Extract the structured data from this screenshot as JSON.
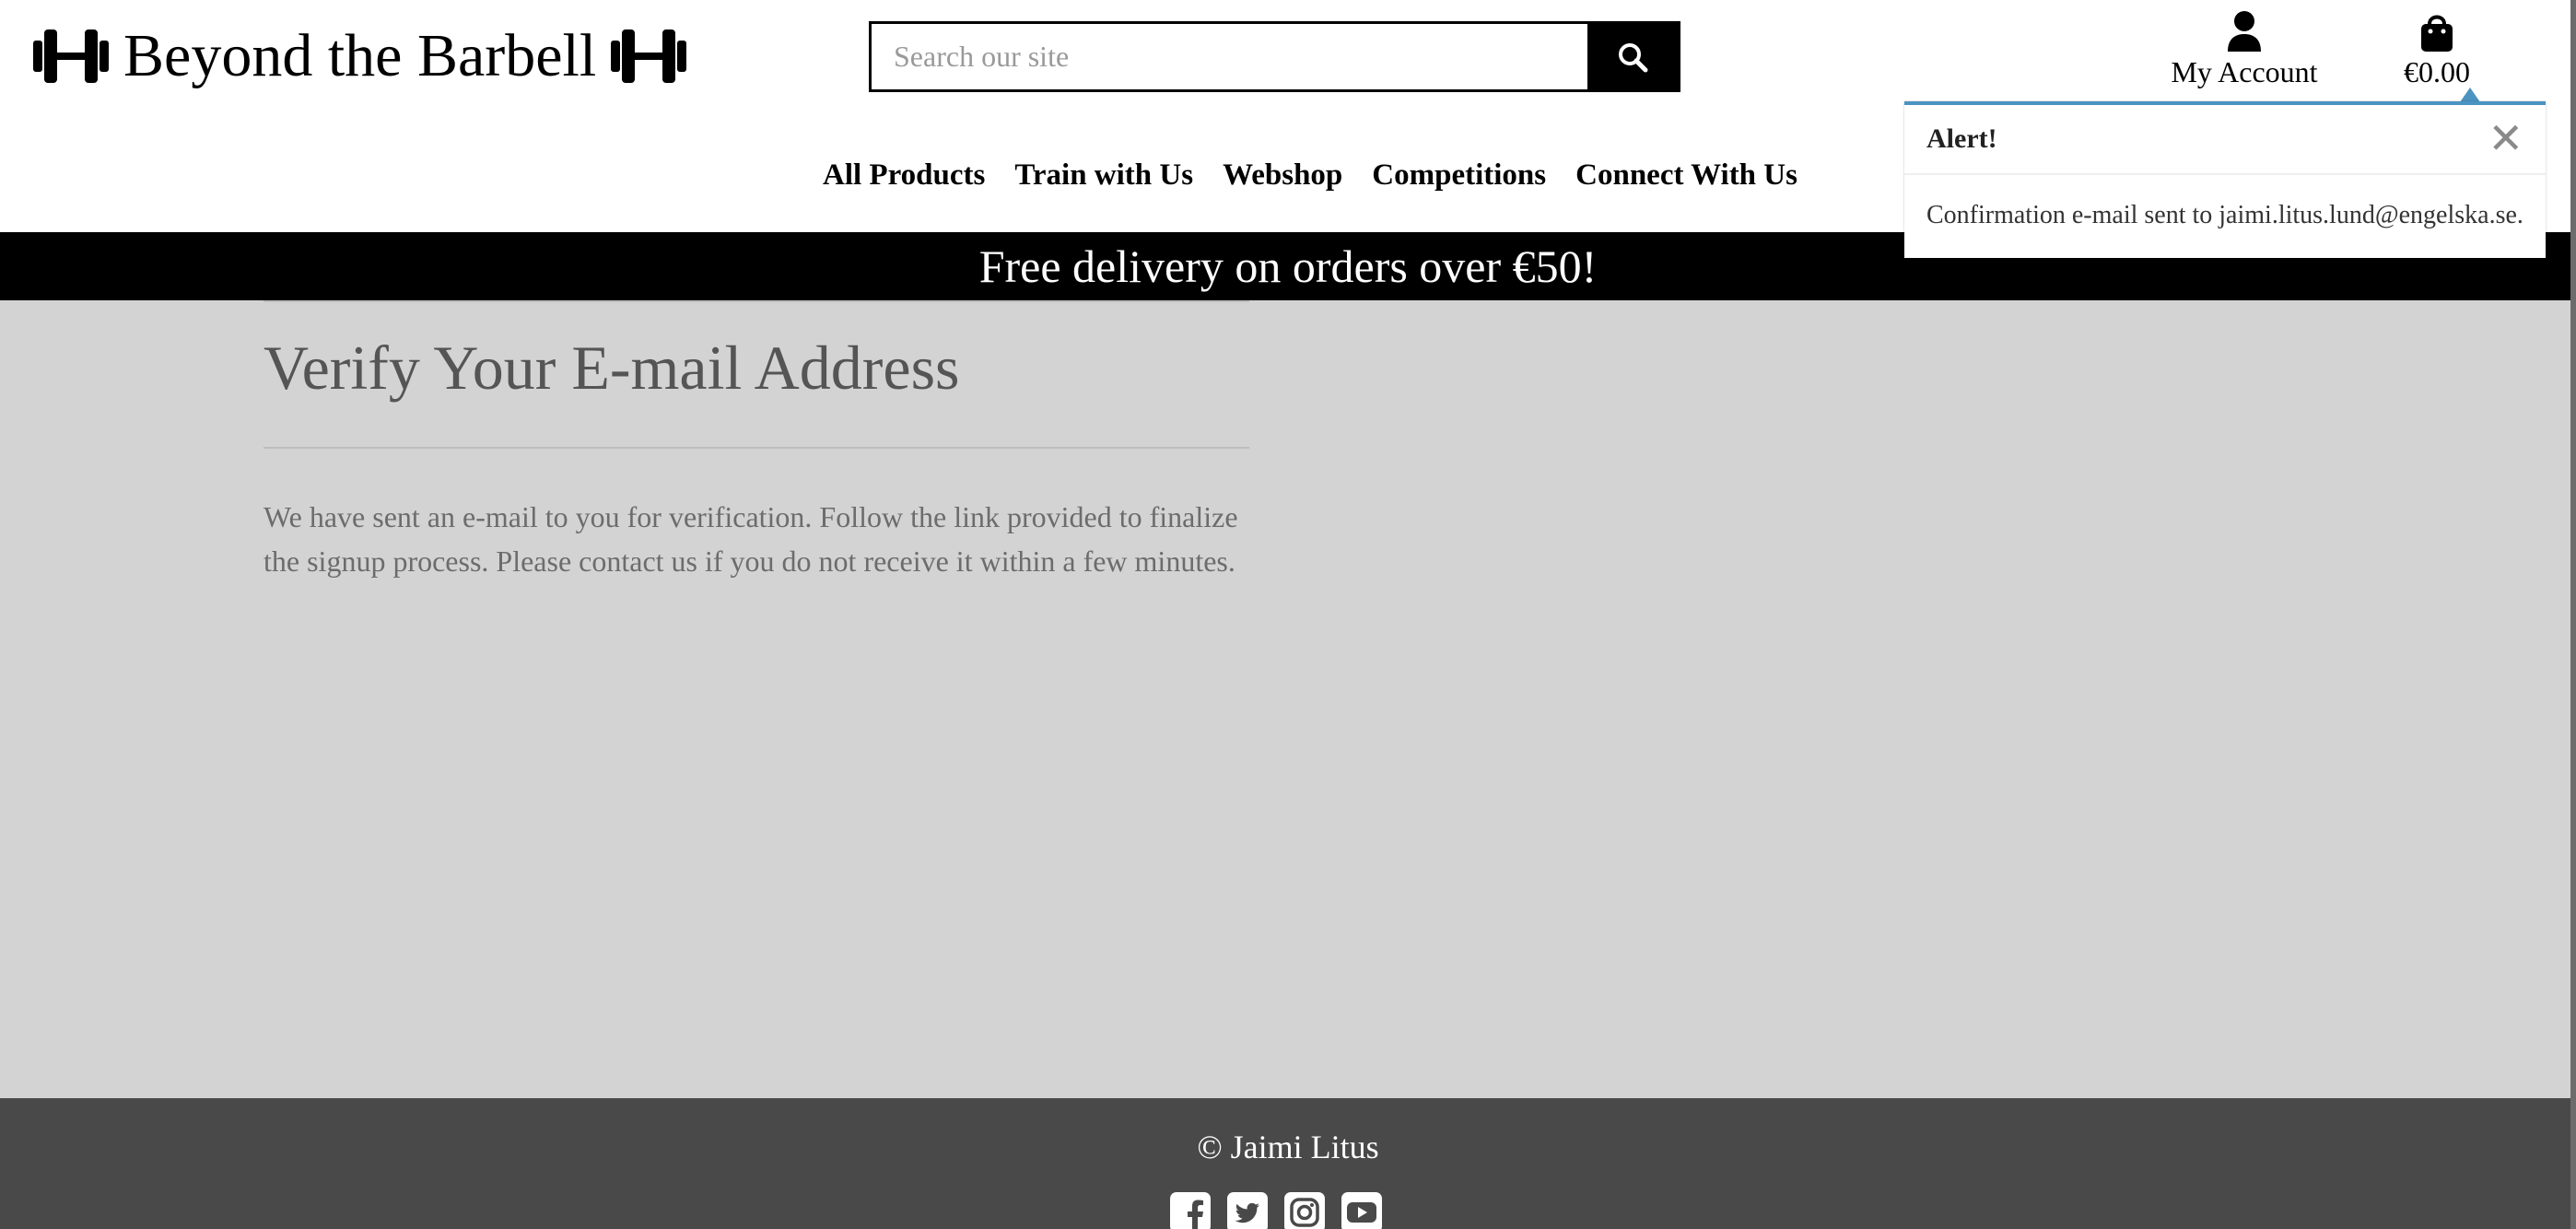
{
  "header": {
    "site_title": "Beyond the Barbell",
    "search_placeholder": "Search our site",
    "account_label": "My Account",
    "bag_total": "€0.00"
  },
  "nav": {
    "items": [
      "All Products",
      "Train with Us",
      "Webshop",
      "Competitions",
      "Connect With Us"
    ]
  },
  "banner": {
    "text": "Free delivery on orders over €50!"
  },
  "main": {
    "title": "Verify Your E-mail Address",
    "body": "We have sent an e-mail to you for verification. Follow the link provided to finalize the signup process. Please contact us if you do not receive it within a few minutes."
  },
  "alert": {
    "title": "Alert!",
    "close_symbol": "✕",
    "message": "Confirmation e-mail sent to jaimi.litus.lund@engelska.se."
  },
  "footer": {
    "copyright": "© Jaimi Litus",
    "socials": [
      "facebook-icon",
      "twitter-icon",
      "instagram-icon",
      "youtube-icon"
    ]
  },
  "colors": {
    "page_bg": "#d3d3d3",
    "banner_bg": "#000000",
    "footer_bg": "#4a4949",
    "alert_accent": "#4b93c1",
    "title_text": "#555555"
  }
}
